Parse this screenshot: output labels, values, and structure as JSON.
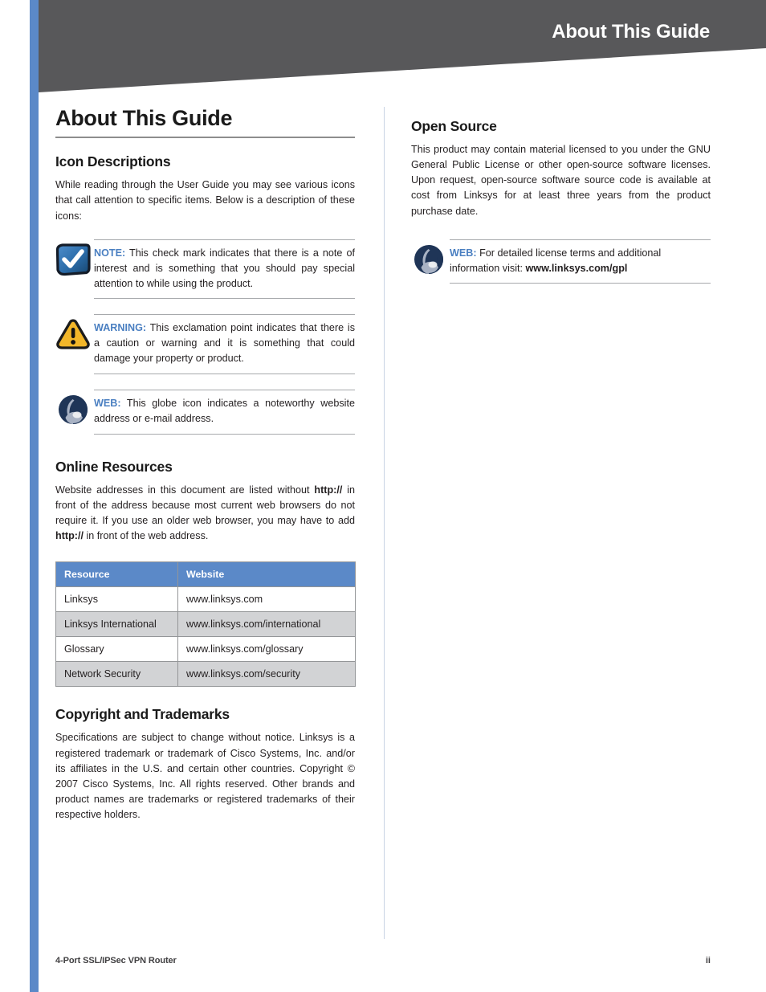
{
  "header": {
    "title": "About This Guide"
  },
  "page": {
    "doc_title": "About This Guide"
  },
  "sections": {
    "icon_descriptions": {
      "heading": "Icon Descriptions",
      "intro": "While reading through the User Guide you may see various icons that call attention to specific items. Below is a description of these icons:",
      "callouts": [
        {
          "icon": "note-check-icon",
          "tag": "NOTE:",
          "text": " This check mark indicates that there is a note of interest and is something that you should pay special attention to while using the product."
        },
        {
          "icon": "warning-triangle-icon",
          "tag": "WARNING:",
          "text": " This exclamation point indicates that there is a caution or warning and it is something that could damage your property or product."
        },
        {
          "icon": "web-globe-icon",
          "tag": "WEB:",
          "text": " This globe icon indicates a noteworthy website address or e-mail address."
        }
      ]
    },
    "online_resources": {
      "heading": "Online Resources",
      "paragraph_part1": "Website addresses in this document are listed without ",
      "paragraph_bold1": "http://",
      "paragraph_part2": " in front of the address because most current web browsers do not require it. If you use an older web browser, you may have to add ",
      "paragraph_bold2": "http://",
      "paragraph_part3": " in front of the web address.",
      "table": {
        "columns": [
          "Resource",
          "Website"
        ],
        "rows": [
          [
            "Linksys",
            "www.linksys.com"
          ],
          [
            "Linksys International",
            "www.linksys.com/international"
          ],
          [
            "Glossary",
            "www.linksys.com/glossary"
          ],
          [
            "Network Security",
            "www.linksys.com/security"
          ]
        ]
      }
    },
    "copyright": {
      "heading": "Copyright and Trademarks",
      "text": "Specifications are subject to change without notice. Linksys is a registered trademark or trademark of Cisco Systems, Inc. and/or its affiliates in the U.S. and certain other countries. Copyright © 2007 Cisco Systems, Inc. All rights reserved. Other brands and product names are trademarks or registered trademarks of their respective holders."
    },
    "open_source": {
      "heading": "Open Source",
      "text": "This product may contain material licensed to you under the GNU General Public License or other open-source software licenses. Upon request, open-source software source code is available at cost from Linksys for at least three years from the product purchase date.",
      "callout": {
        "icon": "web-globe-icon",
        "tag": "WEB:",
        "text": " For detailed license terms and additional information visit: ",
        "link": "www.linksys.com/gpl"
      }
    }
  },
  "footer": {
    "product": "4-Port SSL/IPSec VPN Router",
    "page_number": "ii"
  },
  "colors": {
    "spine_blue": "#5b89c8",
    "banner_gray": "#58585a",
    "table_header_blue": "#5b89c8",
    "table_alt_row": "#d2d3d5",
    "tag_blue": "#4a7fc1",
    "warning_yellow": "#f2b629",
    "note_navy": "#1b3a5c"
  }
}
